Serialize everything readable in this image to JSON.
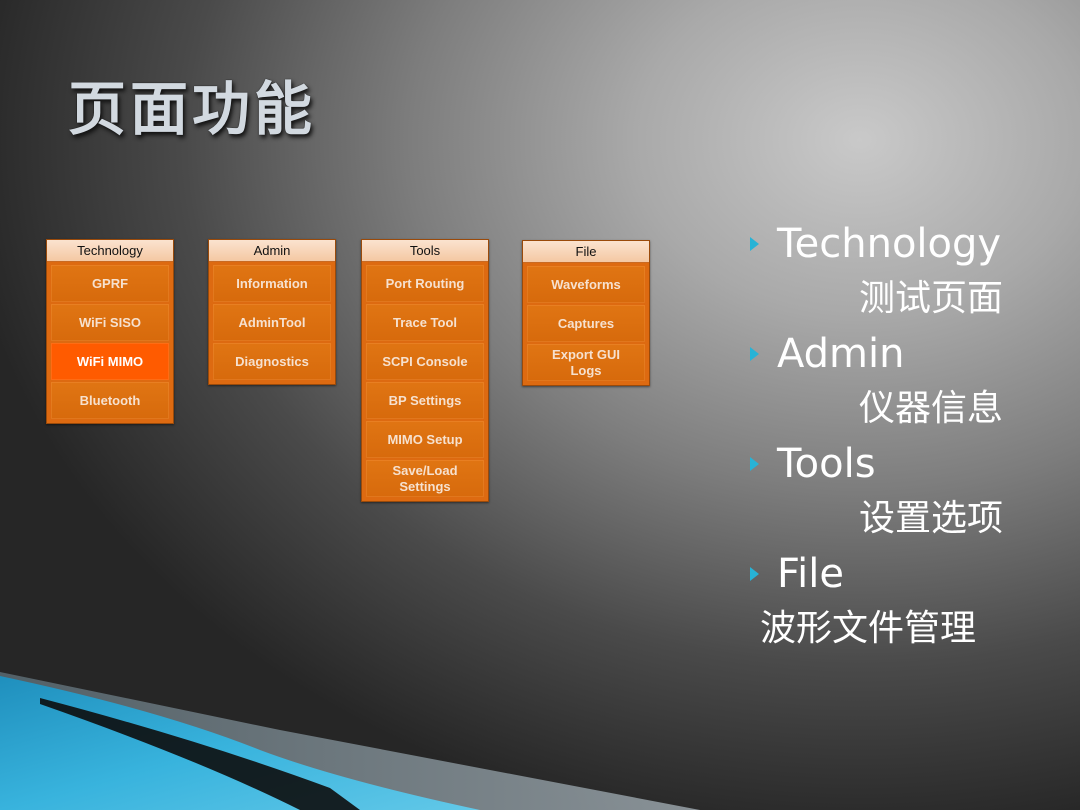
{
  "slide": {
    "title": "页面功能"
  },
  "menus": [
    {
      "header": "Technology",
      "items": [
        {
          "label": "GPRF",
          "active": false
        },
        {
          "label": "WiFi SISO",
          "active": false
        },
        {
          "label": "WiFi MIMO",
          "active": true
        },
        {
          "label": "Bluetooth",
          "active": false
        }
      ]
    },
    {
      "header": "Admin",
      "items": [
        {
          "label": "Information",
          "active": false
        },
        {
          "label": "AdminTool",
          "active": false
        },
        {
          "label": "Diagnostics",
          "active": false
        }
      ]
    },
    {
      "header": "Tools",
      "items": [
        {
          "label": "Port Routing",
          "active": false
        },
        {
          "label": "Trace Tool",
          "active": false
        },
        {
          "label": "SCPI Console",
          "active": false
        },
        {
          "label": "BP Settings",
          "active": false
        },
        {
          "label": "MIMO Setup",
          "active": false
        },
        {
          "label": "Save/Load Settings",
          "active": false
        }
      ]
    },
    {
      "header": "File",
      "items": [
        {
          "label": "Waveforms",
          "active": false
        },
        {
          "label": "Captures",
          "active": false
        },
        {
          "label": "Export GUI Logs",
          "active": false
        }
      ]
    }
  ],
  "bullets": [
    {
      "term": "Technology",
      "desc": "测试页面"
    },
    {
      "term": "Admin",
      "desc": "仪器信息"
    },
    {
      "term": "Tools",
      "desc": "设置选项"
    },
    {
      "term": "File",
      "desc": "波形文件管理"
    }
  ],
  "colors": {
    "menu_item": "#dd6a11",
    "menu_item_active": "#ff5b00",
    "bullet_marker": "#27b3d6",
    "swoosh": "#2aa9d2"
  }
}
